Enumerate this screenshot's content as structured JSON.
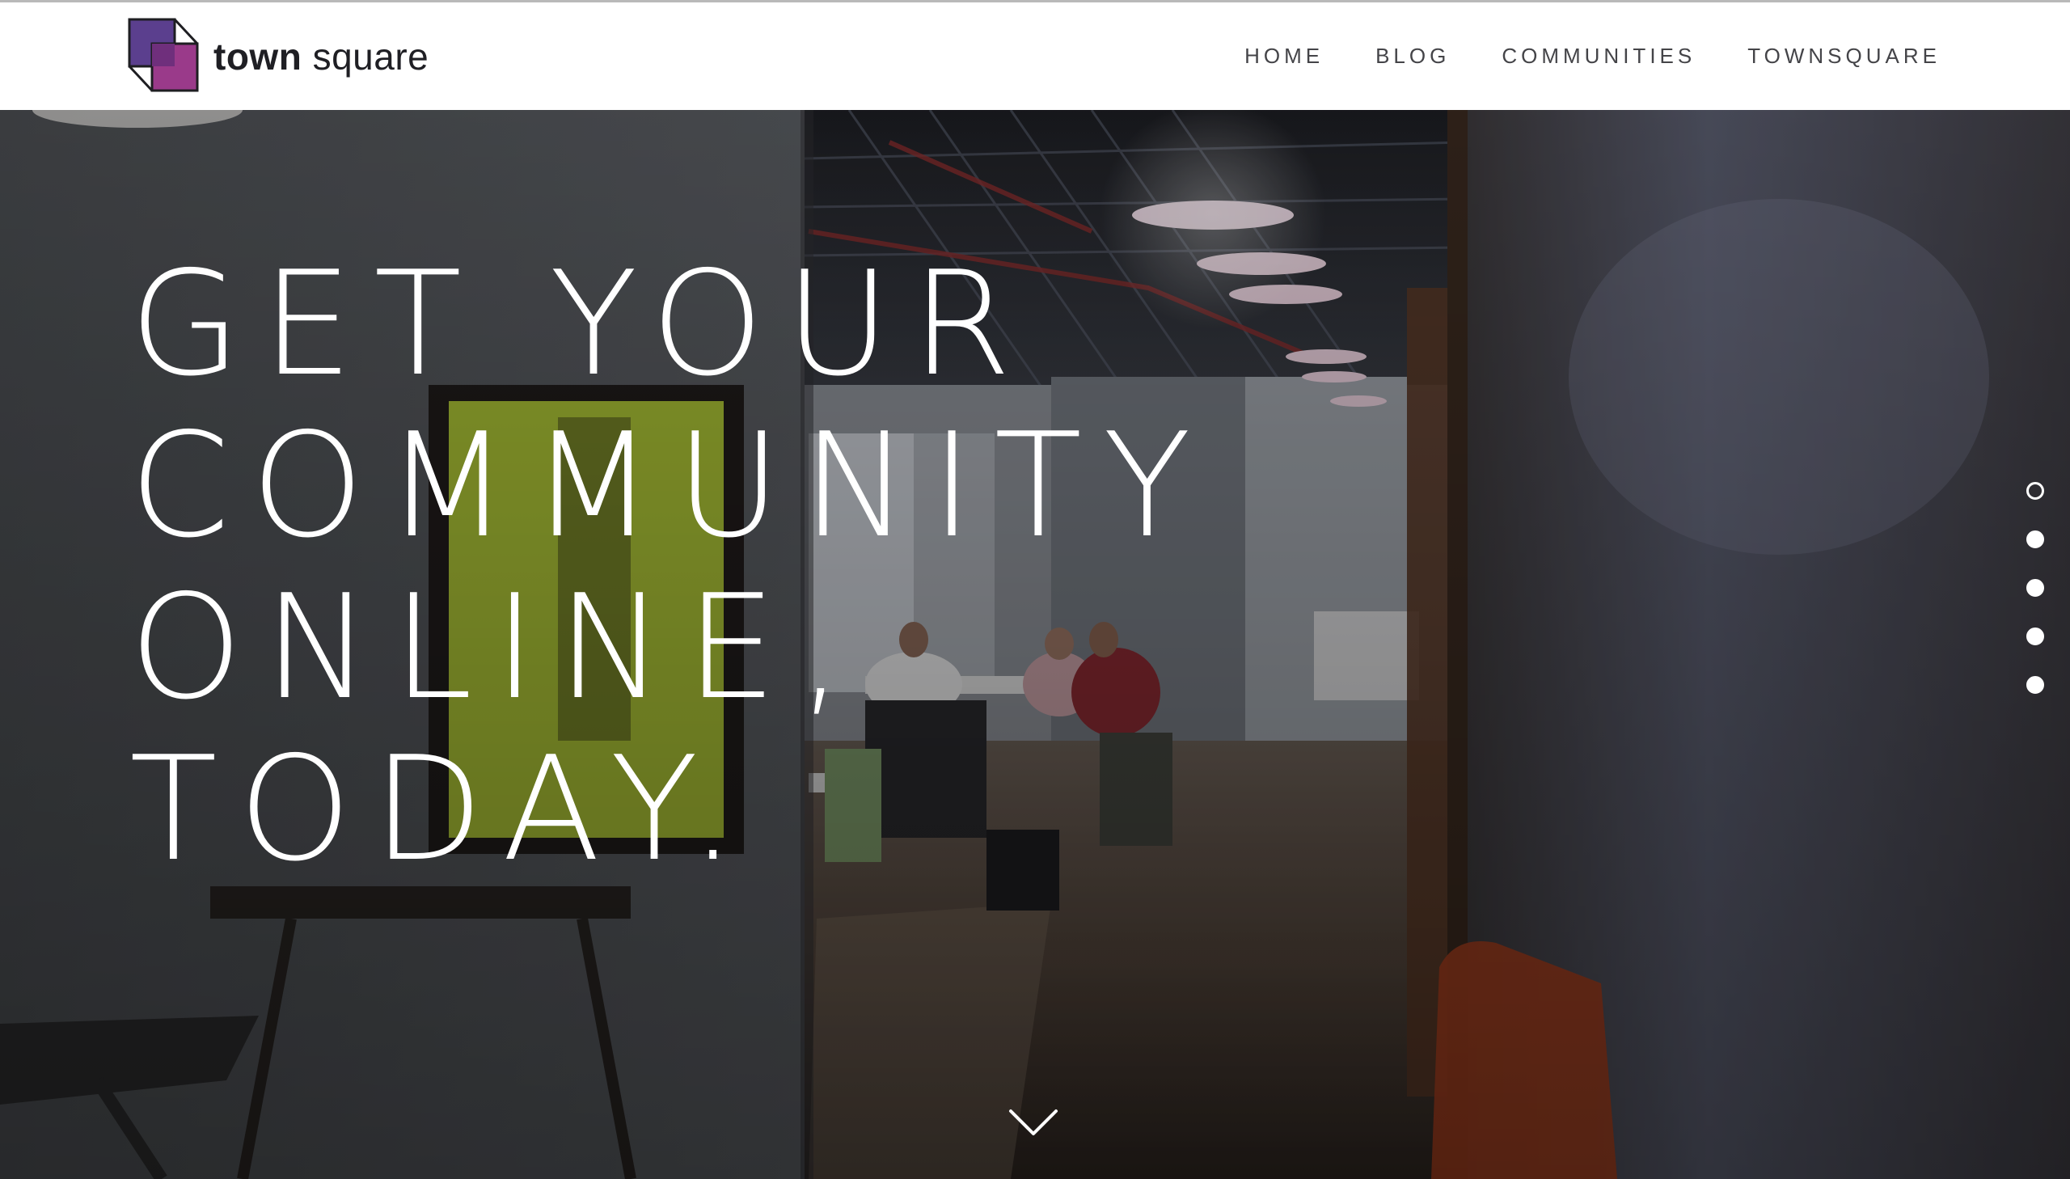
{
  "brand": {
    "name_bold": "town",
    "name_light": "square",
    "colors": {
      "dark_purple": "#5b3f8e",
      "magenta": "#9a3a8a",
      "outline": "#1e1e22"
    }
  },
  "nav": {
    "items": [
      {
        "label": "HOME"
      },
      {
        "label": "BLOG"
      },
      {
        "label": "COMMUNITIES"
      },
      {
        "label": "TOWNSQUARE"
      }
    ]
  },
  "hero": {
    "headline": {
      "line1": "GET YOUR",
      "line2": "COMMUNITY",
      "line3": "ONLINE,",
      "line4": "TODAY."
    },
    "slides": {
      "count": 5,
      "active_index": 0
    },
    "scroll_icon": "chevron-down-icon",
    "background_description_colors": {
      "wall": "#4a4e55",
      "poster": "#a9c035",
      "lamp": "#f2dcea",
      "chair": "#b5431f"
    }
  }
}
